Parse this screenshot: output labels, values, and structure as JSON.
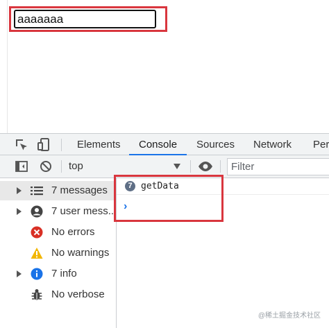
{
  "page": {
    "input_value": "aaaaaaa"
  },
  "devtools": {
    "tabs": [
      "Elements",
      "Console",
      "Sources",
      "Network",
      "Perf"
    ],
    "active_tab": "Console",
    "toolbar": {
      "context": "top",
      "filter_placeholder": "Filter"
    },
    "sidebar": {
      "items": [
        {
          "label": "7 messages",
          "icon": "list-icon",
          "expandable": true,
          "selected": true
        },
        {
          "label": "7 user mess...",
          "icon": "user-icon",
          "expandable": true,
          "selected": false
        },
        {
          "label": "No errors",
          "icon": "error-icon",
          "expandable": false,
          "selected": false
        },
        {
          "label": "No warnings",
          "icon": "warning-icon",
          "expandable": false,
          "selected": false
        },
        {
          "label": "7 info",
          "icon": "info-icon",
          "expandable": true,
          "selected": false
        },
        {
          "label": "No verbose",
          "icon": "bug-icon",
          "expandable": false,
          "selected": false
        }
      ]
    },
    "console": {
      "entry_count": "7",
      "entry_text": "getData",
      "prompt": "›"
    }
  },
  "watermark": "@稀土掘金技术社区",
  "colors": {
    "accent_blue": "#1a73e8",
    "highlight_red": "#d9363e",
    "error_red": "#d93025",
    "warning_yellow": "#f2b600",
    "info_blue": "#1a73e8"
  }
}
